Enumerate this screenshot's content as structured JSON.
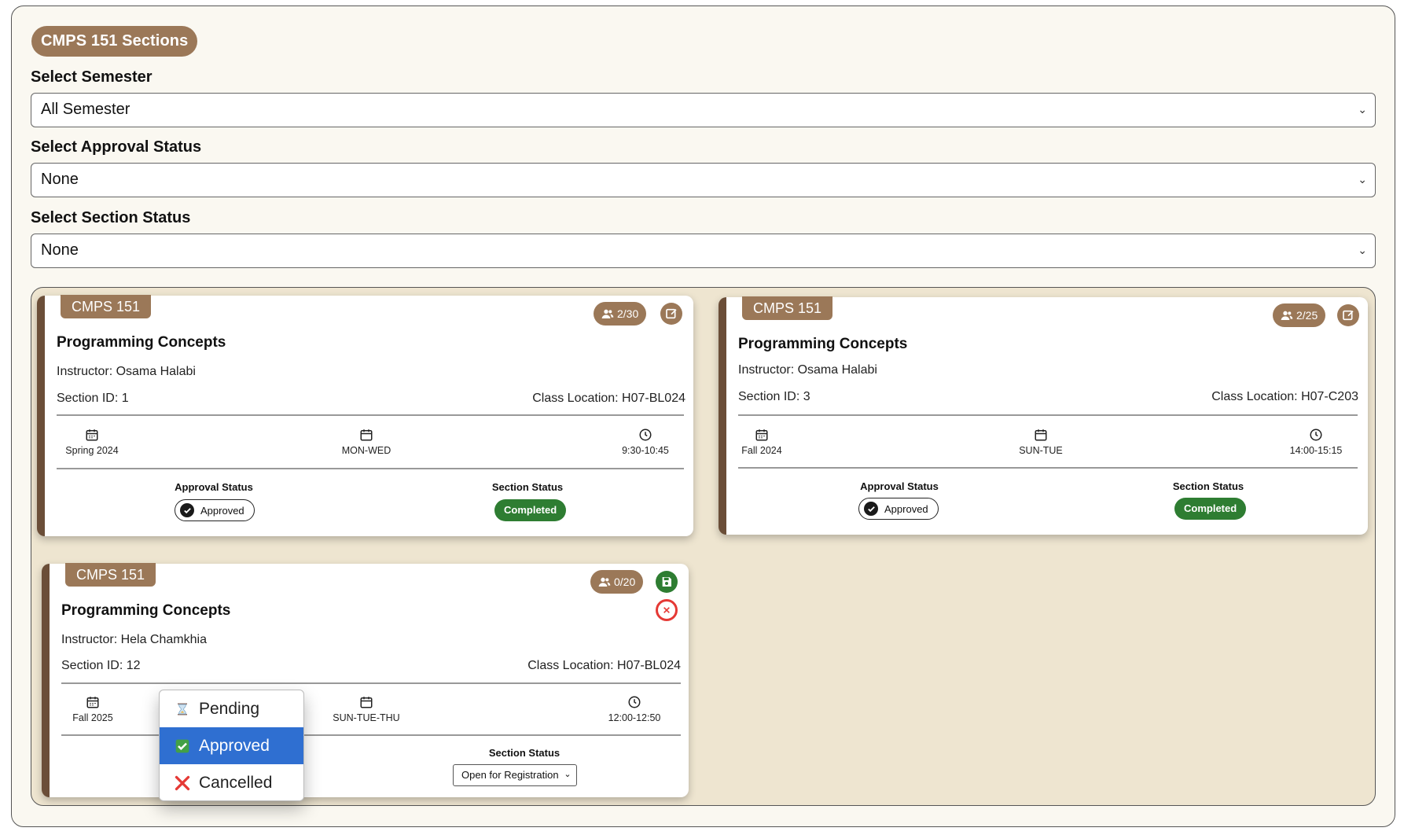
{
  "title": "CMPS 151 Sections",
  "filters": {
    "semester": {
      "label": "Select Semester",
      "value": "All Semester"
    },
    "approval": {
      "label": "Select Approval Status",
      "value": "None"
    },
    "section": {
      "label": "Select Section Status",
      "value": "None"
    }
  },
  "cards": [
    {
      "course": "CMPS 151",
      "enrollment": "2/30",
      "title": "Programming Concepts",
      "instructor": "Instructor: Osama Halabi",
      "section_id": "Section ID: 1",
      "location": "Class Location: H07-BL024",
      "semester": "Spring 2024",
      "days": "MON-WED",
      "time": "9:30-10:45",
      "approval_head": "Approval Status",
      "approval": "Approved",
      "status_head": "Section Status",
      "status": "Completed"
    },
    {
      "course": "CMPS 151",
      "enrollment": "2/25",
      "title": "Programming Concepts",
      "instructor": "Instructor: Osama Halabi",
      "section_id": "Section ID: 3",
      "location": "Class Location: H07-C203",
      "semester": "Fall 2024",
      "days": "SUN-TUE",
      "time": "14:00-15:15",
      "approval_head": "Approval Status",
      "approval": "Approved",
      "status_head": "Section Status",
      "status": "Completed"
    },
    {
      "course": "CMPS 151",
      "enrollment": "0/20",
      "title": "Programming Concepts",
      "instructor": "Instructor: Hela Chamkhia",
      "section_id": "Section ID: 12",
      "location": "Class Location: H07-BL024",
      "semester": "Fall 2025",
      "days": "SUN-TUE-THU",
      "time": "12:00-12:50",
      "status_head": "Section Status",
      "status": "Open for Registration"
    }
  ],
  "approval_dropdown": {
    "options": [
      "Pending",
      "Approved",
      "Cancelled"
    ],
    "selected": "Approved"
  },
  "colors": {
    "brand_brown": "#9b7858",
    "dark_brown": "#6b4e38",
    "area_bg": "#eee5d0",
    "success_green": "#2e7d32",
    "cancel_red": "#e53935",
    "select_blue": "#2f6fd1"
  }
}
